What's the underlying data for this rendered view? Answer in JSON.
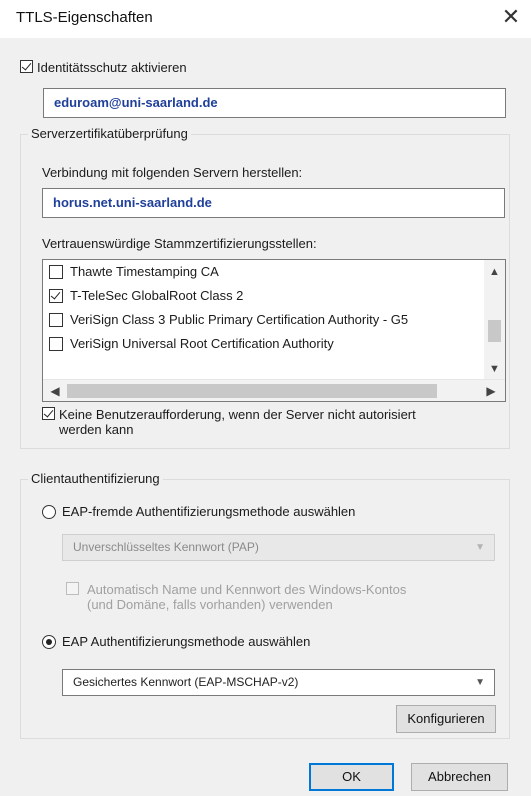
{
  "dialog": {
    "title": "TTLS-Eigenschaften",
    "close_glyph": "✕"
  },
  "identity": {
    "checkbox_label": "Identitätsschutz aktivieren",
    "checked": true,
    "value": "eduroam@uni-saarland.de"
  },
  "server_cert": {
    "legend": "Serverzertifikatüberprüfung",
    "connect_label": "Verbindung mit folgenden Servern herstellen:",
    "server_value": "horus.net.uni-saarland.de",
    "trusted_label": "Vertrauenswürdige Stammzertifizierungsstellen:",
    "authorities": [
      {
        "label": "Thawte Timestamping CA",
        "checked": false
      },
      {
        "label": "T-TeleSec GlobalRoot Class 2",
        "checked": true
      },
      {
        "label": "VeriSign Class 3 Public Primary Certification Authority - G5",
        "checked": false
      },
      {
        "label": "VeriSign Universal Root Certification Authority",
        "checked": false
      }
    ],
    "no_prompt_label_line1": "Keine Benutzeraufforderung, wenn der Server nicht autorisiert",
    "no_prompt_label_line2": "werden kann",
    "no_prompt_checked": true
  },
  "client_auth": {
    "legend": "Clientauthentifizierung",
    "non_eap_label": "EAP-fremde Authentifizierungsmethode auswählen",
    "non_eap_selected": false,
    "non_eap_method": "Unverschlüsseltes Kennwort (PAP)",
    "auto_windows_line1": "Automatisch Name und Kennwort des Windows-Kontos",
    "auto_windows_line2": "(und Domäne, falls vorhanden) verwenden",
    "eap_label": "EAP Authentifizierungsmethode auswählen",
    "eap_selected": true,
    "eap_method": "Gesichertes Kennwort (EAP-MSCHAP-v2)",
    "configure_label": "Konfigurieren"
  },
  "footer": {
    "ok_label": "OK",
    "cancel_label": "Abbrechen"
  },
  "colors": {
    "accent": "#0078d7",
    "input_text": "#1f3f99"
  }
}
